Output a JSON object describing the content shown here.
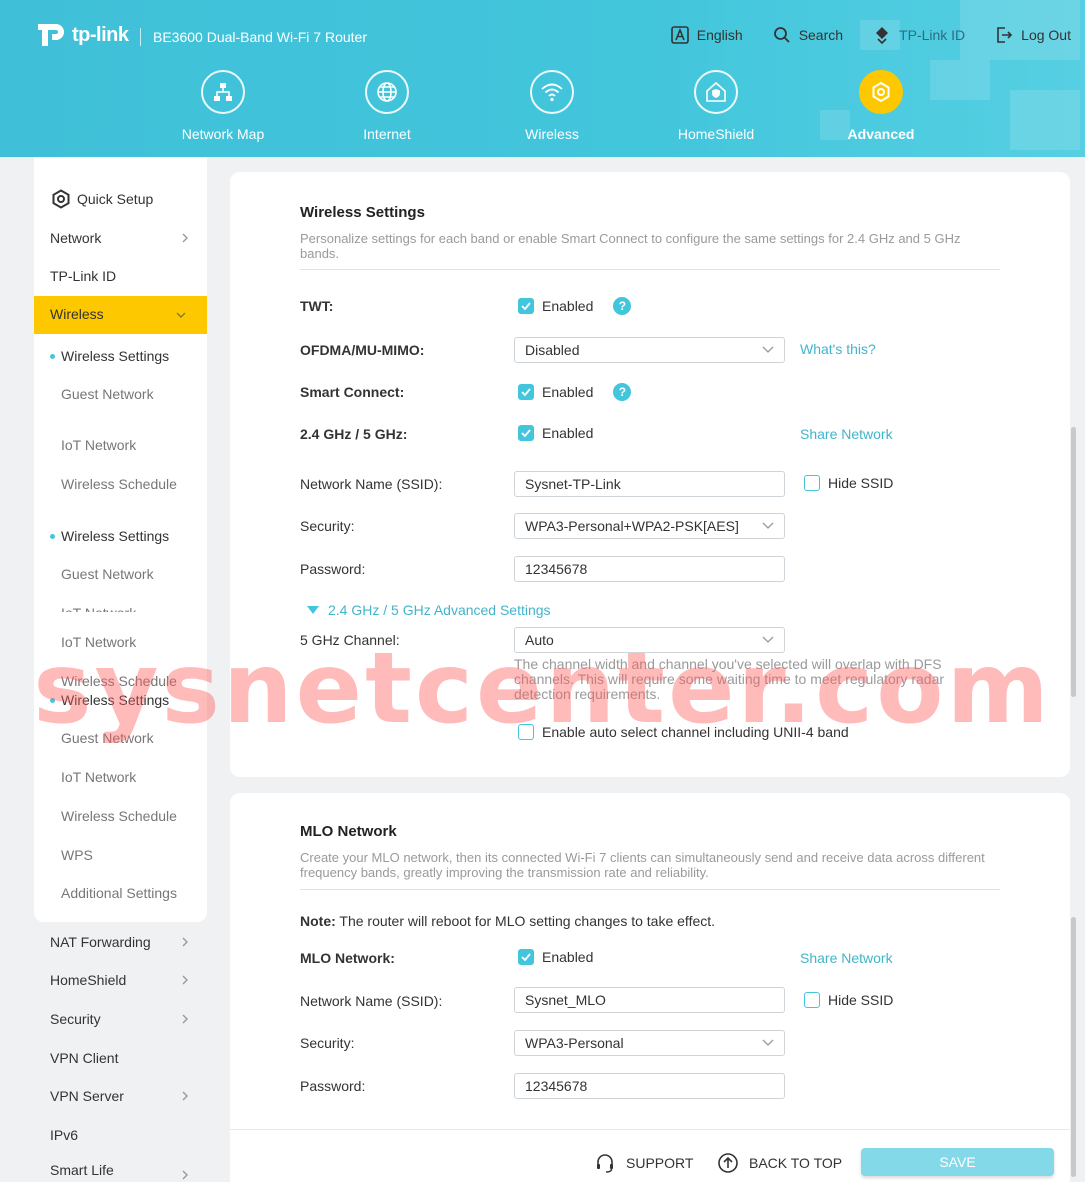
{
  "header": {
    "brand": "tp-link",
    "model": "BE3600 Dual-Band Wi-Fi 7 Router",
    "links": [
      {
        "label": "English",
        "icon": "language-icon"
      },
      {
        "label": "Search",
        "icon": "search-icon"
      },
      {
        "label": "TP-Link ID",
        "icon": "tplink-id-icon"
      },
      {
        "label": "Log Out",
        "icon": "logout-icon"
      }
    ],
    "nav": [
      {
        "label": "Network Map",
        "icon": "network-map-icon"
      },
      {
        "label": "Internet",
        "icon": "globe-icon"
      },
      {
        "label": "Wireless",
        "icon": "wifi-icon"
      },
      {
        "label": "HomeShield",
        "icon": "homeshield-icon"
      },
      {
        "label": "Advanced",
        "icon": "gear-icon",
        "active": true
      }
    ]
  },
  "sidebar": {
    "quick_setup": "Quick Setup",
    "network": "Network",
    "tplink_id": "TP-Link ID",
    "wireless": "Wireless",
    "sub1": [
      "Wireless Settings",
      "Guest Network",
      "IoT Network",
      "Wireless Schedule"
    ],
    "sub2": [
      "Wireless Settings",
      "Guest Network",
      "IoT Network",
      "IoT Network",
      "Wireless Schedule"
    ],
    "sub3": [
      "Wireless Settings",
      "Guest Network",
      "IoT Network",
      "Wireless Schedule",
      "WPS",
      "Additional Settings"
    ],
    "after": [
      "NAT Forwarding",
      "HomeShield",
      "Security",
      "VPN Client",
      "VPN Server",
      "IPv6",
      "Smart Life"
    ]
  },
  "wireless_settings": {
    "title": "Wireless Settings",
    "description": "Personalize settings for each band or enable Smart Connect to configure the same settings for 2.4 GHz and 5 GHz bands.",
    "twt_label": "TWT:",
    "twt_value": "Enabled",
    "ofdma_label": "OFDMA/MU-MIMO:",
    "ofdma_value": "Disabled",
    "whats_this": "What's this?",
    "smart_connect_label": "Smart Connect:",
    "smart_connect_value": "Enabled",
    "band_label": "2.4 GHz / 5 GHz:",
    "band_value": "Enabled",
    "share_network": "Share Network",
    "ssid_label": "Network Name (SSID):",
    "ssid_value": "Sysnet-TP-Link",
    "hide_ssid": "Hide SSID",
    "security_label": "Security:",
    "security_value": "WPA3-Personal+WPA2-PSK[AES]",
    "password_label": "Password:",
    "password_value": "12345678",
    "advanced_toggle": "2.4 GHz / 5 GHz Advanced Settings",
    "channel_label": "5 GHz Channel:",
    "channel_value": "Auto",
    "channel_note": "The channel width and channel you've selected will overlap with DFS channels. This will require some waiting time to meet regulatory radar detection requirements.",
    "unii4_label": "Enable auto select channel including UNII-4 band"
  },
  "mlo": {
    "title": "MLO Network",
    "description": "Create your MLO network, then its connected Wi-Fi 7 clients can simultaneously send and receive data across different frequency bands, greatly improving the transmission rate and reliability.",
    "note_bold": "Note:",
    "note_text": " The router will reboot for MLO setting changes to take effect.",
    "mlo_label": "MLO Network:",
    "mlo_value": "Enabled",
    "share_network": "Share Network",
    "ssid_label": "Network Name (SSID):",
    "ssid_value": "Sysnet_MLO",
    "hide_ssid": "Hide SSID",
    "security_label": "Security:",
    "security_value": "WPA3-Personal",
    "password_label": "Password:",
    "password_value": "12345678"
  },
  "bottom": {
    "support": "SUPPORT",
    "back_to_top": "BACK TO TOP",
    "save": "SAVE"
  },
  "watermark": "sysnetcenter.com",
  "colors": {
    "accent": "#42c6dc",
    "active_yellow": "#fdc800"
  }
}
